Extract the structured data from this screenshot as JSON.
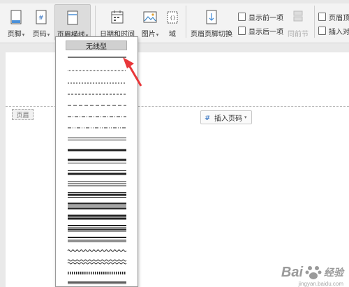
{
  "ribbon": {
    "footer_label": "页脚",
    "pagenum_label": "页码",
    "headerline_label": "页眉横线",
    "datetime_label": "日期和时间",
    "picture_label": "图片",
    "field_label": "域",
    "switch_label": "页眉页脚切换",
    "show_prev_label": "显示前一项",
    "show_next_label": "显示后一项",
    "same_as_prev_label": "同前节",
    "header_top_label": "页眉顶",
    "insert_align_label": "插入对",
    "caret": "▾"
  },
  "dropdown": {
    "none_label": "无线型",
    "options": [
      "single-thin",
      "dotted-fine",
      "dashed-short",
      "dashed-medium",
      "dashed-long",
      "dash-dot",
      "dash-dot-dot",
      "double-thin",
      "single-thick",
      "thick-thin",
      "thin-thick",
      "triple",
      "thick-thin-thick",
      "thin-thick-thin",
      "double-thick",
      "multi-band",
      "thin-double",
      "wavy",
      "double-wavy",
      "diagonal-hatch",
      "emboss"
    ]
  },
  "document": {
    "header_label": "页眉",
    "insert_pagenum_label": "插入页码"
  },
  "watermark": {
    "brand_a": "Bai",
    "brand_b": "经验",
    "url": "jingyan.baidu.com"
  },
  "colors": {
    "accent_arrow": "#e8373a",
    "hover_bg": "#dcdcdc"
  }
}
